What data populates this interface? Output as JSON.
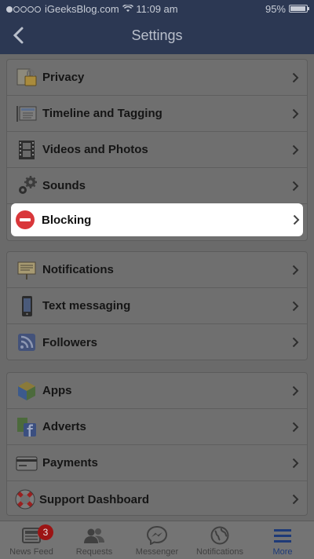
{
  "status_bar": {
    "carrier": "iGeeksBlog.com",
    "time": "11:09 am",
    "battery": "95%",
    "battery_level": 0.95
  },
  "nav": {
    "title": "Settings"
  },
  "groups": [
    {
      "rows": [
        {
          "label": "Privacy",
          "icon": "lock-icon"
        },
        {
          "label": "Timeline and Tagging",
          "icon": "timeline-icon"
        },
        {
          "label": "Videos and Photos",
          "icon": "film-icon"
        },
        {
          "label": "Sounds",
          "icon": "gears-icon"
        },
        {
          "label": "Blocking",
          "icon": "block-icon",
          "highlighted": true
        }
      ]
    },
    {
      "rows": [
        {
          "label": "Notifications",
          "icon": "notice-board-icon"
        },
        {
          "label": "Text messaging",
          "icon": "phone-icon"
        },
        {
          "label": "Followers",
          "icon": "rss-icon"
        }
      ]
    },
    {
      "rows": [
        {
          "label": "Apps",
          "icon": "cube-icon"
        },
        {
          "label": "Adverts",
          "icon": "adverts-icon"
        },
        {
          "label": "Payments",
          "icon": "credit-card-icon"
        },
        {
          "label": "Support Dashboard",
          "icon": "lifebuoy-icon"
        }
      ]
    }
  ],
  "tab_bar": {
    "tabs": [
      {
        "label": "News Feed",
        "badge": "3"
      },
      {
        "label": "Requests"
      },
      {
        "label": "Messenger"
      },
      {
        "label": "Notifications"
      },
      {
        "label": "More",
        "active": true
      }
    ]
  },
  "colors": {
    "nav_bg": "#2c3853",
    "overlay_bg": "#6a6a6a",
    "highlight_bg": "#ffffff",
    "block_red": "#d9373a",
    "active_tab": "#1e3a78",
    "badge_red": "#9c1414"
  }
}
